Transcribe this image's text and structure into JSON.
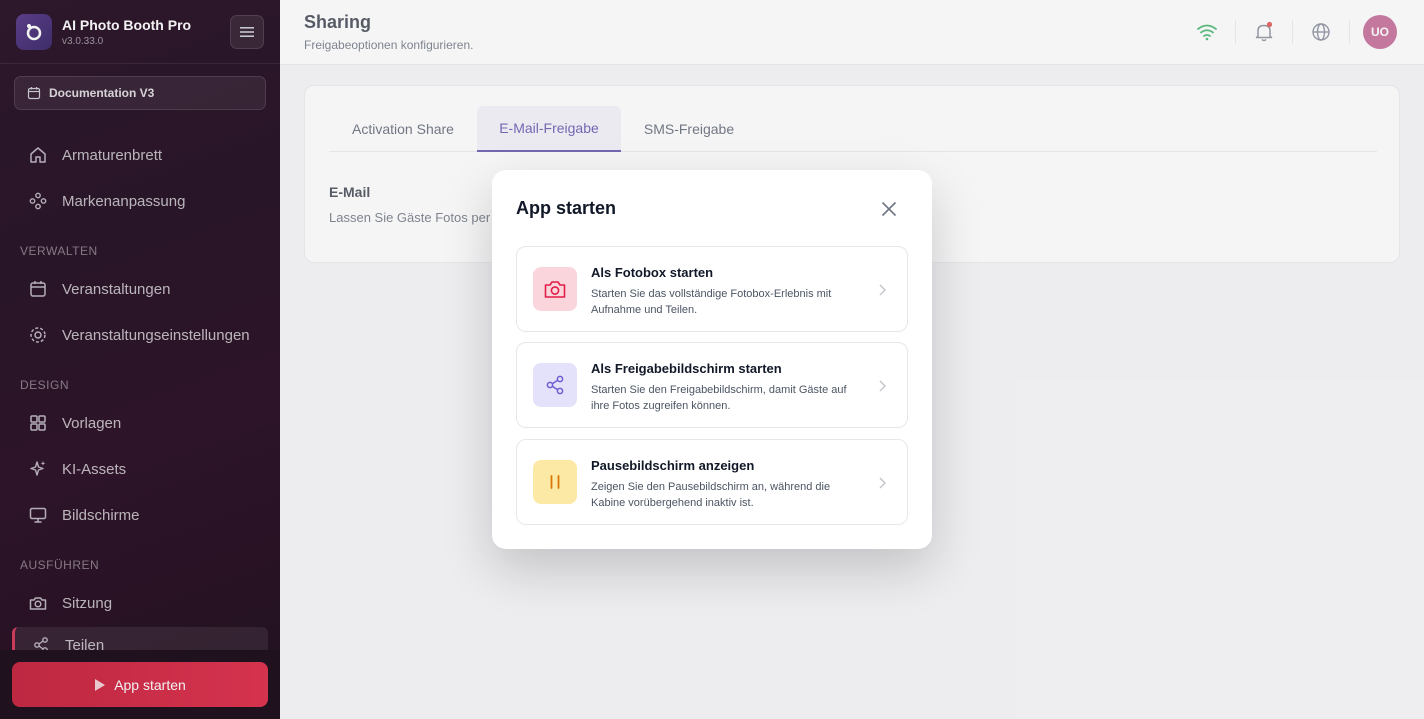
{
  "app": {
    "name": "AI Photo Booth Pro",
    "version": "v3.0.33.0"
  },
  "event_selector": {
    "label": "Documentation V3"
  },
  "sidebar": {
    "items": [
      {
        "label": "Armaturenbrett"
      },
      {
        "label": "Markenanpassung"
      },
      {
        "label": "Veranstaltungen"
      },
      {
        "label": "Veranstaltungseinstellungen"
      },
      {
        "label": "Vorlagen"
      },
      {
        "label": "KI-Assets"
      },
      {
        "label": "Bildschirme"
      },
      {
        "label": "Sitzung"
      },
      {
        "label": "Teilen"
      }
    ],
    "sections": [
      "VERWALTEN",
      "DESIGN",
      "AUSFÜHREN"
    ],
    "start_label": "App starten"
  },
  "header": {
    "title": "Sharing",
    "subtitle": "Freigabeoptionen konfigurieren.",
    "avatar_initials": "UO"
  },
  "tabs": [
    {
      "label": "Activation Share"
    },
    {
      "label": "E-Mail-Freigabe"
    },
    {
      "label": "SMS-Freigabe"
    }
  ],
  "content": {
    "field_title": "E-Mail",
    "field_desc": "Lassen Sie Gäste Fotos per"
  },
  "modal": {
    "title": "App starten",
    "options": [
      {
        "title": "Als Fotobox starten",
        "desc": "Starten Sie das vollständige Fotobox-Erlebnis mit Aufnahme und Teilen.",
        "icon": "camera-icon"
      },
      {
        "title": "Als Freigabebildschirm starten",
        "desc": "Starten Sie den Freigabebildschirm, damit Gäste auf ihre Fotos zugreifen können.",
        "icon": "share-icon"
      },
      {
        "title": "Pausebildschirm anzeigen",
        "desc": "Zeigen Sie den Pausebildschirm an, während die Kabine vorübergehend inaktiv ist.",
        "icon": "pause-icon"
      }
    ]
  },
  "colors": {
    "accent": "#3b2a9a",
    "brand_red": "#d23a5a",
    "wifi_green": "#16a34a"
  }
}
